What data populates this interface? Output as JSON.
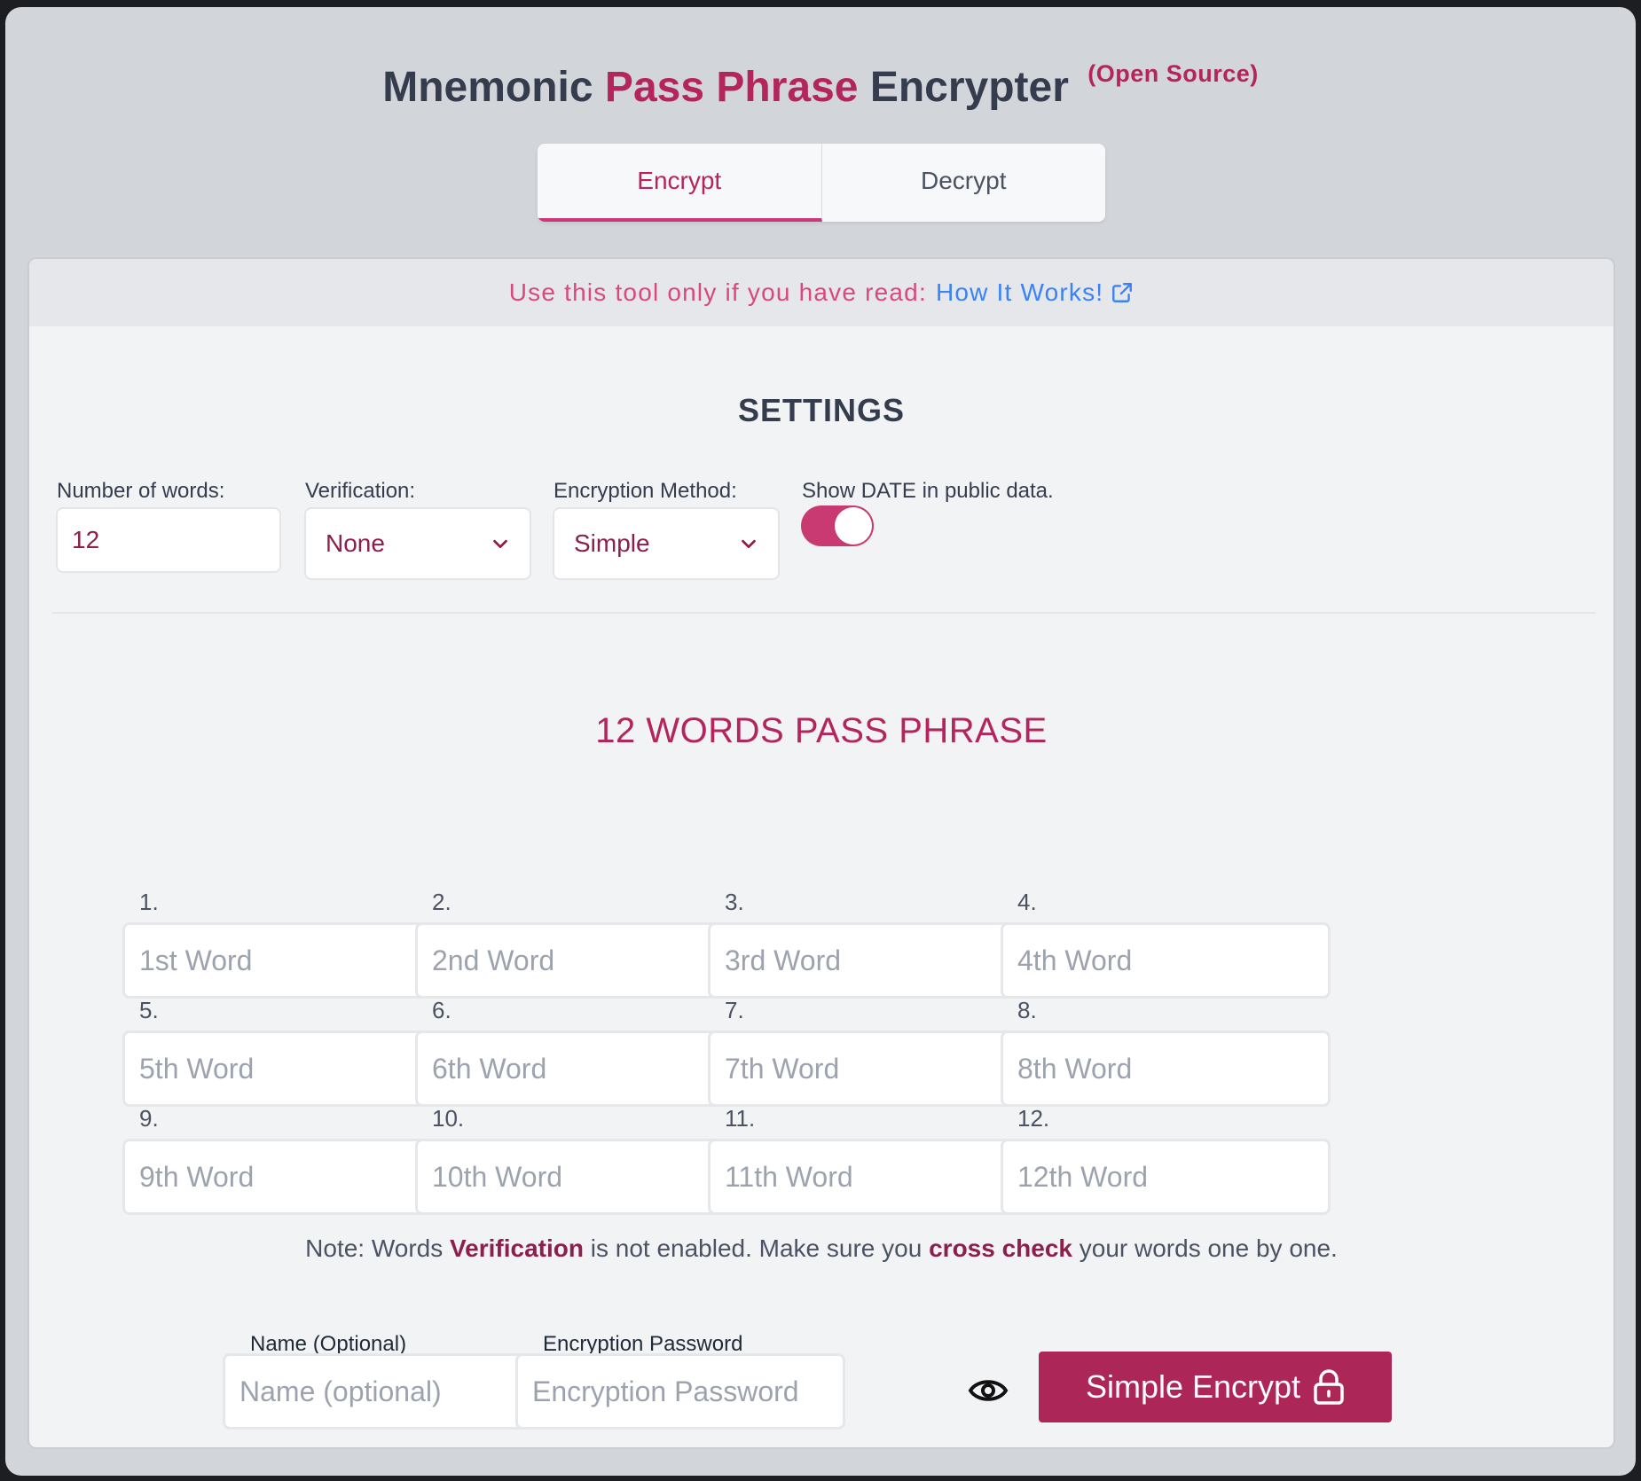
{
  "header": {
    "title_part1": "Mnemonic",
    "title_accent": "Pass Phrase",
    "title_part2": "Encrypter",
    "title_sup": "(Open Source)"
  },
  "tabs": [
    {
      "label": "Encrypt",
      "active": true
    },
    {
      "label": "Decrypt",
      "active": false
    }
  ],
  "banner": {
    "text": "Use this tool only if you have read:",
    "link_text": "How It Works!",
    "link_icon": "external-link-icon"
  },
  "settings": {
    "title": "SETTINGS",
    "num_words_label": "Number of words:",
    "num_words_value": "12",
    "verification_label": "Verification:",
    "verification_value": "None",
    "method_label": "Encryption Method:",
    "method_value": "Simple",
    "date_label": "Show DATE in public data.",
    "date_toggle_on": true
  },
  "words": {
    "title": "12 WORDS PASS PHRASE",
    "items": [
      {
        "num": "1.",
        "placeholder": "1st Word"
      },
      {
        "num": "2.",
        "placeholder": "2nd Word"
      },
      {
        "num": "3.",
        "placeholder": "3rd Word"
      },
      {
        "num": "4.",
        "placeholder": "4th Word"
      },
      {
        "num": "5.",
        "placeholder": "5th Word"
      },
      {
        "num": "6.",
        "placeholder": "6th Word"
      },
      {
        "num": "7.",
        "placeholder": "7th Word"
      },
      {
        "num": "8.",
        "placeholder": "8th Word"
      },
      {
        "num": "9.",
        "placeholder": "9th Word"
      },
      {
        "num": "10.",
        "placeholder": "10th Word"
      },
      {
        "num": "11.",
        "placeholder": "11th Word"
      },
      {
        "num": "12.",
        "placeholder": "12th Word"
      }
    ]
  },
  "note": {
    "p1": "Note: Words ",
    "b1": "Verification",
    "p2": " is not enabled. Make sure you ",
    "b2": "cross check",
    "p3": " your words one by one."
  },
  "footer": {
    "name_label": "Name (Optional)",
    "name_placeholder": "Name (optional)",
    "password_label": "Encryption Password",
    "password_placeholder": "Encryption Password",
    "eye_icon": "eye-icon",
    "button_label": "Simple Encrypt",
    "button_icon": "lock-icon"
  },
  "colors": {
    "accent": "#b4245d",
    "button": "#ad2658",
    "link": "#3b82f6",
    "banner_text": "#d9487f"
  }
}
